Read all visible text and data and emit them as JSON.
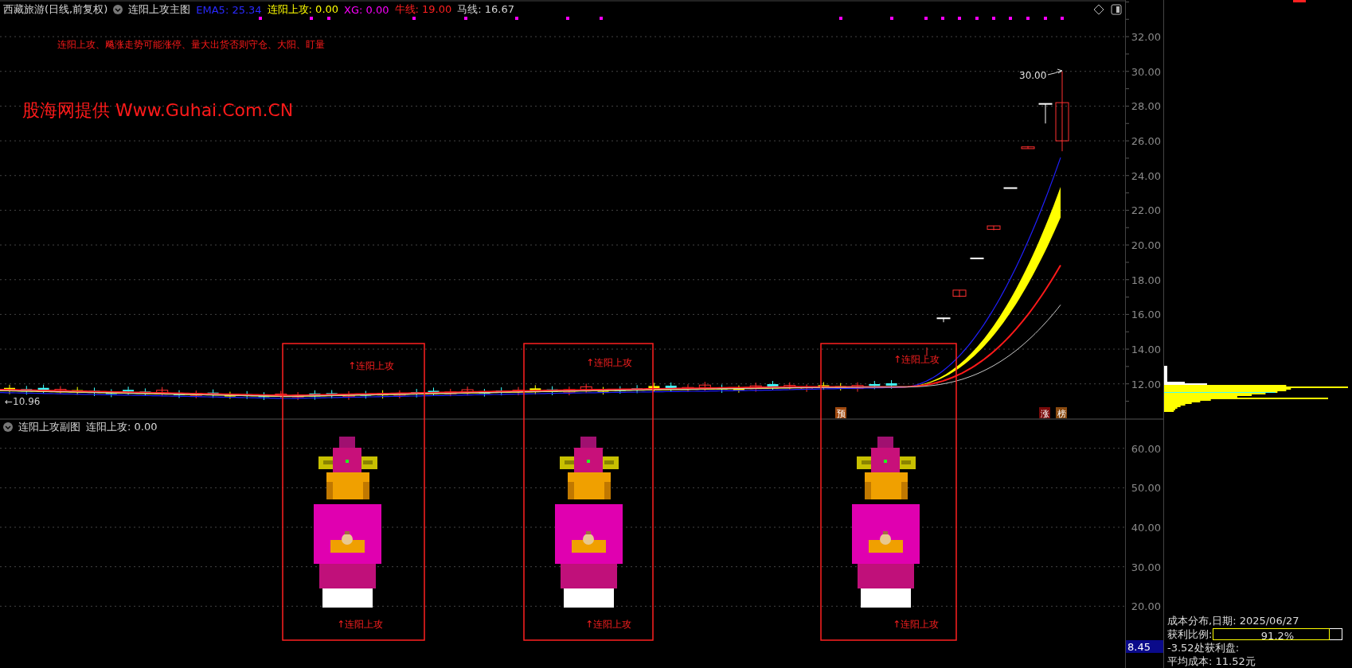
{
  "header": {
    "security": "西藏旅游(日线,前复权)",
    "indicator": "连阳上攻主图",
    "values": [
      {
        "text": "EMA5: 25.34",
        "color": "#2a2aff"
      },
      {
        "text": "连阳上攻: 0.00",
        "color": "#ffff00"
      },
      {
        "text": "XG: 0.00",
        "color": "#ff00ff"
      },
      {
        "text": "牛线: 19.00",
        "color": "#ff2020"
      },
      {
        "text": "马线: 16.67",
        "color": "#d0d0d0"
      }
    ]
  },
  "note": "连阳上攻、飚涨走势可能涨停、量大出货否则守仓、大阳、盯量",
  "banner": "股海网提供 Www.Guhai.Com.CN",
  "price_axis": [
    "32.00",
    "30.00",
    "28.00",
    "26.00",
    "24.00",
    "22.00",
    "20.00",
    "18.00",
    "16.00",
    "14.00",
    "12.00"
  ],
  "high_label": "30.00",
  "low_label": "←10.96",
  "signals": [
    {
      "top_label": "↑连阳上攻",
      "bottom_label": "↑连阳上攻"
    },
    {
      "top_label": "↑连阳上攻",
      "bottom_label": "↑连阳上攻"
    },
    {
      "top_label": "↑连阳上攻",
      "bottom_label": "↑连阳上攻"
    }
  ],
  "tags": [
    {
      "text": "预",
      "color": "#a04a10"
    },
    {
      "text": "涨",
      "color": "#7a0a0a"
    },
    {
      "text": "榜",
      "color": "#8a4a10"
    }
  ],
  "sub_header": {
    "indicator": "连阳上攻副图",
    "value": "连阳上攻: 0.00"
  },
  "sub_axis": [
    "60.00",
    "50.00",
    "40.00",
    "30.00",
    "20.00"
  ],
  "current_value": "8.45",
  "cost_panel": {
    "title": "成本分布,日期: 2025/06/27",
    "ratio_label": "获利比例:",
    "ratio": {
      "level": 0.912,
      "text": "91.2%"
    },
    "profit_line": "-3.52处获利盘:",
    "average": "平均成本: 11.52元"
  }
}
